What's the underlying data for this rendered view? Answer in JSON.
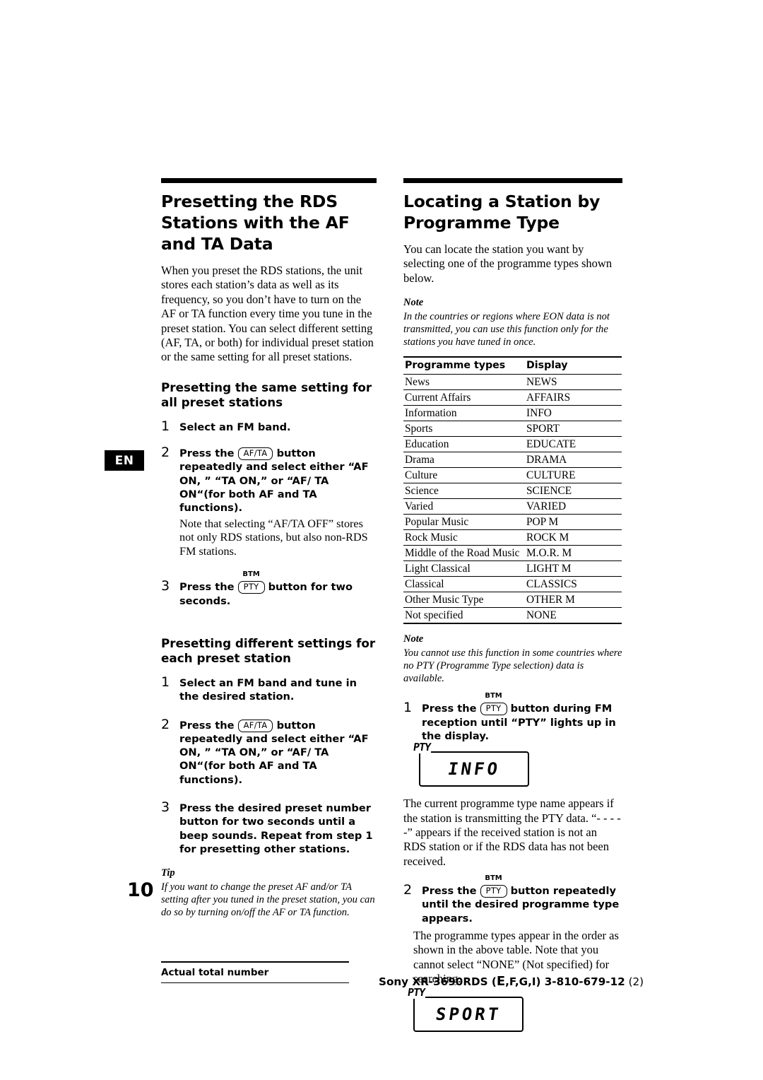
{
  "page": {
    "number": "10",
    "lang_tab": "EN"
  },
  "left": {
    "title": "Presetting the RDS Stations with the AF and TA Data",
    "intro": "When you preset the RDS stations, the unit stores each station’s data as well as its frequency, so you don’t have to turn on the AF or TA function every time you tune in the preset station.  You can select different setting (AF, TA, or both) for individual preset station or the same setting for all preset stations.",
    "sub1": "Presetting the same setting for all preset stations",
    "steps1": [
      {
        "num": "1",
        "bold": "Select an FM band."
      },
      {
        "num": "2",
        "bold_pre": "Press the",
        "key": "AF/TA",
        "bold_post": "button repeatedly and select either “AF ON, ” “TA ON,” or “AF/ TA ON“(for both AF and TA functions).",
        "plain": "Note that selecting “AF/TA OFF” stores not only RDS stations, but also non-RDS FM stations."
      },
      {
        "num": "3",
        "bold_pre": "Press the",
        "key": "PTY",
        "key_top": "BTM",
        "bold_post": "button for two seconds."
      }
    ],
    "sub2": "Presetting different settings for each preset station",
    "steps2": [
      {
        "num": "1",
        "bold": "Select an FM band and tune in the desired station."
      },
      {
        "num": "2",
        "bold_pre": "Press the",
        "key": "AF/TA",
        "bold_post": "button repeatedly and select either “AF ON, ” “TA ON,” or “AF/ TA ON“(for both AF and TA functions)."
      },
      {
        "num": "3",
        "bold": "Press the desired preset number button for two seconds until a beep sounds. Repeat from step 1 for presetting other stations."
      }
    ],
    "tip_head": "Tip",
    "tip_body": "If you want to change the preset AF and/or TA setting after you tuned in the preset station,  you can do so by turning on/off the AF or TA function."
  },
  "right": {
    "title": "Locating a Station by Programme Type",
    "intro": "You can locate the station you want by selecting one of the programme types shown below.",
    "note1_head": "Note",
    "note1_body": "In the countries or regions where EON data is not transmitted, you can use this function only for the stations you have tuned in once.",
    "table": {
      "headers": [
        "Programme types",
        "Display"
      ],
      "rows": [
        [
          "News",
          "NEWS"
        ],
        [
          "Current Affairs",
          "AFFAIRS"
        ],
        [
          "Information",
          "INFO"
        ],
        [
          "Sports",
          "SPORT"
        ],
        [
          "Education",
          "EDUCATE"
        ],
        [
          "Drama",
          "DRAMA"
        ],
        [
          "Culture",
          "CULTURE"
        ],
        [
          "Science",
          "SCIENCE"
        ],
        [
          "Varied",
          "VARIED"
        ],
        [
          "Popular Music",
          "POP M"
        ],
        [
          "Rock Music",
          "ROCK M"
        ],
        [
          "Middle of the Road Music",
          "M.O.R. M"
        ],
        [
          "Light Classical",
          "LIGHT M"
        ],
        [
          "Classical",
          "CLASSICS"
        ],
        [
          "Other Music Type",
          "OTHER M"
        ],
        [
          "Not specified",
          "NONE"
        ]
      ]
    },
    "note2_head": "Note",
    "note2_body": "You cannot use this function in some countries where no PTY (Programme Type selection) data is available.",
    "steps": [
      {
        "num": "1",
        "bold_pre": "Press the",
        "key": "PTY",
        "key_top": "BTM",
        "bold_post": "button during FM reception until “PTY” lights up in the display."
      },
      {
        "num": "2",
        "bold_pre": "Press the",
        "key": "PTY",
        "key_top": "BTM",
        "bold_post": "button repeatedly until the desired programme type appears."
      }
    ],
    "after_step1": "The current programme type name appears if the station is transmitting the PTY data. “- - - - -” appears if the received station is not an RDS station or if the RDS data has not been received.",
    "after_step2": "The programme types appear in the order as shown in the above table.  Note that you cannot select “NONE” (Not specified) for searching.",
    "display1": {
      "label": "PTY",
      "text": "INFO"
    },
    "display2": {
      "label": "PTY",
      "text": "SPORT"
    }
  },
  "footer": {
    "left_text": "Actual total number",
    "right_prefix": "Sony XR-3690RDS (",
    "right_e": "E",
    "right_mid": ",F,G,I) 3-810-679-",
    "right_bold": "12",
    "right_suffix": " (2)"
  }
}
